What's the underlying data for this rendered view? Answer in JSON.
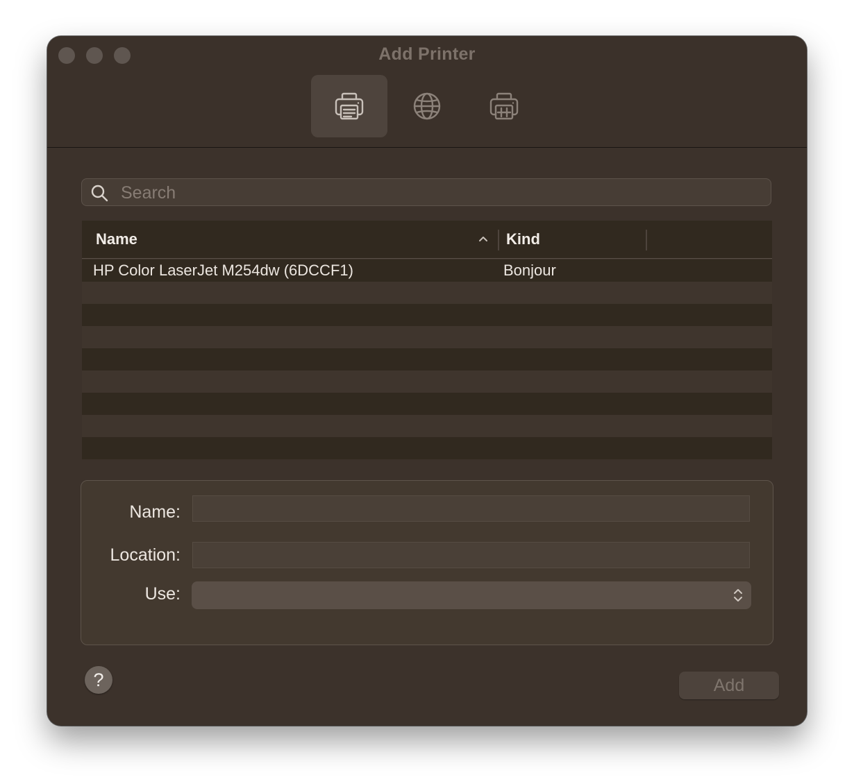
{
  "window": {
    "title": "Add Printer"
  },
  "toolbar": {
    "items": [
      {
        "name": "default-printers",
        "icon": "printer-icon",
        "active": true
      },
      {
        "name": "ip-printers",
        "icon": "globe-icon",
        "active": false
      },
      {
        "name": "windows-printers",
        "icon": "printer-grid-icon",
        "active": false
      }
    ]
  },
  "search": {
    "placeholder": "Search",
    "value": ""
  },
  "table": {
    "columns": [
      "Name",
      "Kind"
    ],
    "sort_column": "Name",
    "sort_direction": "ascending",
    "rows": [
      {
        "name": "HP Color LaserJet M254dw (6DCCF1)",
        "kind": "Bonjour"
      }
    ]
  },
  "form": {
    "name_label": "Name:",
    "name_value": "",
    "location_label": "Location:",
    "location_value": "",
    "use_label": "Use:",
    "use_value": ""
  },
  "footer": {
    "help_label": "?",
    "add_label": "Add"
  },
  "colors": {
    "window_bg": "#3c322b",
    "row_dark": "#31291f",
    "row_light": "#3f352d",
    "disabled_text": "#7f756d"
  }
}
